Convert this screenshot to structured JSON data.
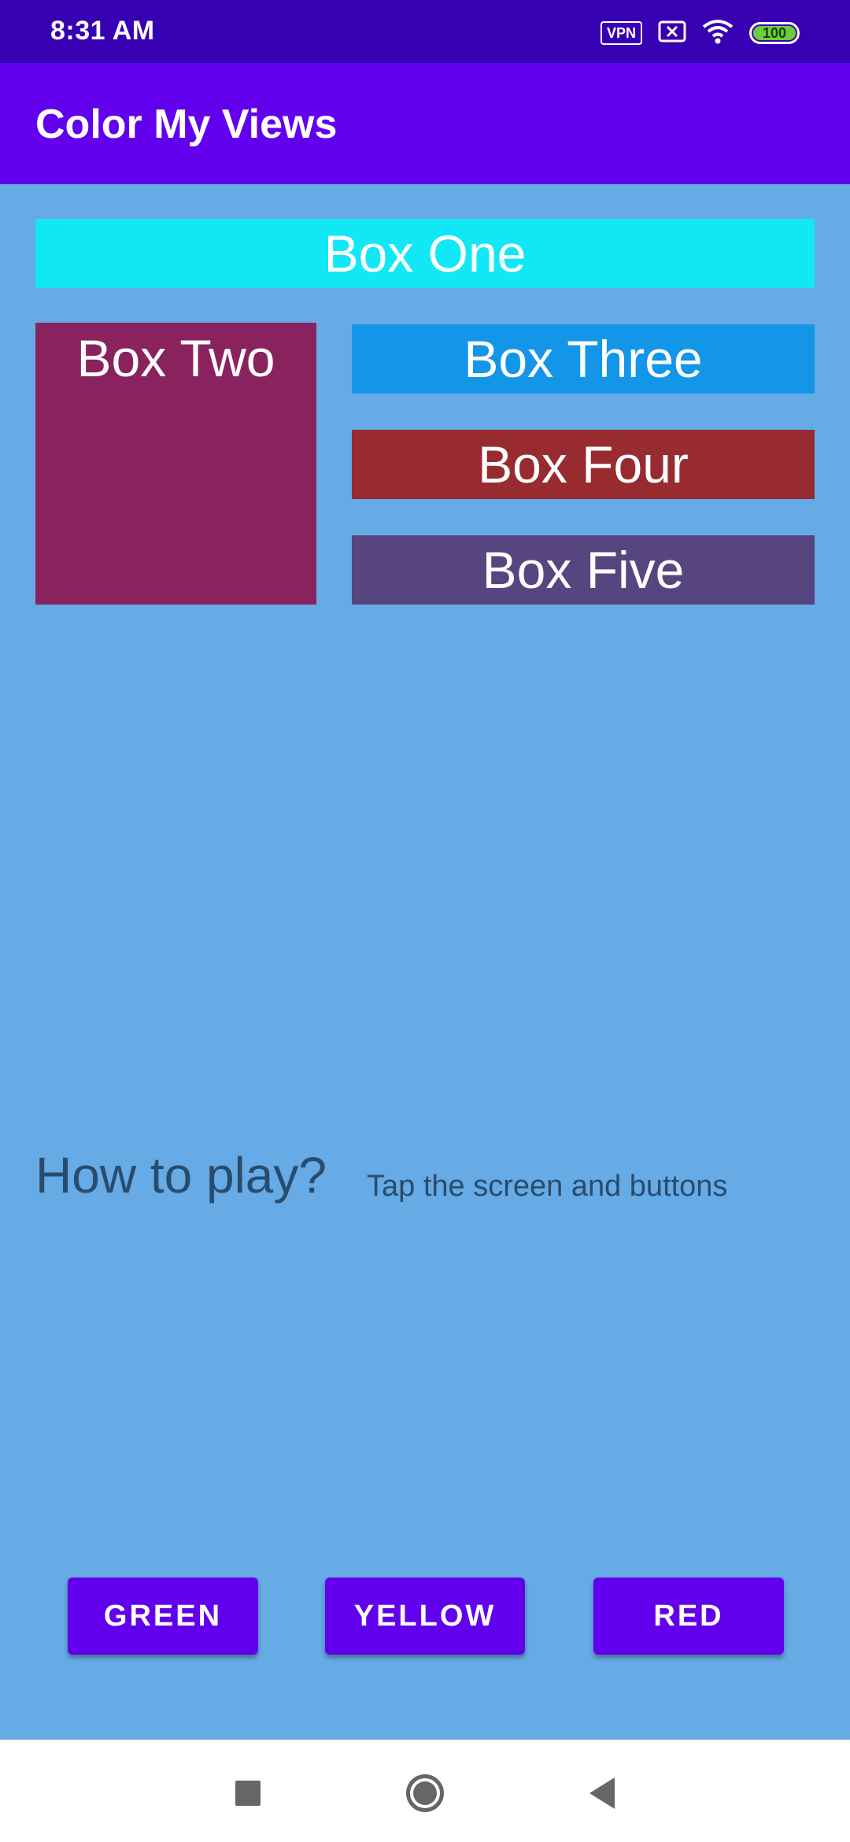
{
  "status_bar": {
    "time": "8:31 AM",
    "vpn_label": "VPN",
    "battery_level": "100",
    "icons": [
      "vpn-icon",
      "no-sim-icon",
      "wifi-icon",
      "battery-icon"
    ]
  },
  "app_bar": {
    "title": "Color My Views"
  },
  "boxes": {
    "box_one": "Box One",
    "box_two": "Box Two",
    "box_three": "Box Three",
    "box_four": "Box Four",
    "box_five": "Box Five"
  },
  "box_colors": {
    "box_one": "#12e8f5",
    "box_two": "#8a235d",
    "box_three": "#1496e8",
    "box_four": "#972b30",
    "box_five": "#57457f"
  },
  "instructions": {
    "label": "How to play?",
    "text": "Tap the screen and buttons"
  },
  "buttons": {
    "green": "GREEN",
    "yellow": "YELLOW",
    "red": "RED"
  },
  "nav_bar": {
    "icons": [
      "recents-icon",
      "home-icon",
      "back-icon"
    ]
  },
  "colors": {
    "status_bar": "#3700b3",
    "app_bar": "#6200ee",
    "background": "#66aae6",
    "button": "#6200ee",
    "instruction_text": "#294c6c"
  }
}
